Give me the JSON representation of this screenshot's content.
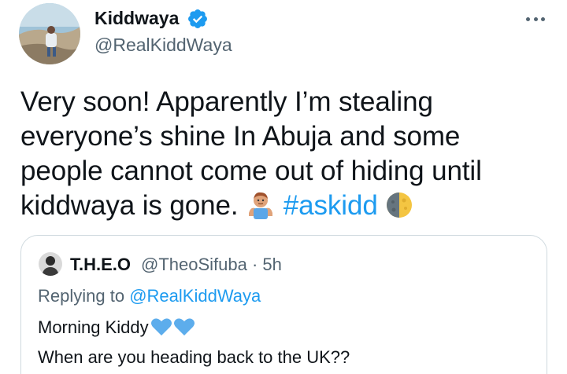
{
  "author": {
    "display_name": "Kiddwaya",
    "handle": "@RealKiddWaya",
    "verified": true
  },
  "tweet": {
    "lines": [
      "Very soon! Apparently I’m stealing",
      "everyone’s shine In Abuja and some",
      "people cannot come out of hiding until",
      "kiddwaya is gone."
    ],
    "emoji_1": "person-shrugging-emoji",
    "hashtag": "#askidd",
    "emoji_2": "last-quarter-moon-emoji"
  },
  "quoted_tweet": {
    "display_name": "T.H.E.O",
    "meta": "@TheoSifuba · 5h",
    "replying_label": "Replying to",
    "replying_handle": "@RealKiddWaya",
    "body_line_1": "Morning Kiddy",
    "emoji": "blue-heart-emoji",
    "body_line_2": "When are you heading back to the UK??"
  },
  "colors": {
    "accent": "#1d9bf0",
    "secondary_text": "#536471",
    "border": "#cfd9de"
  }
}
